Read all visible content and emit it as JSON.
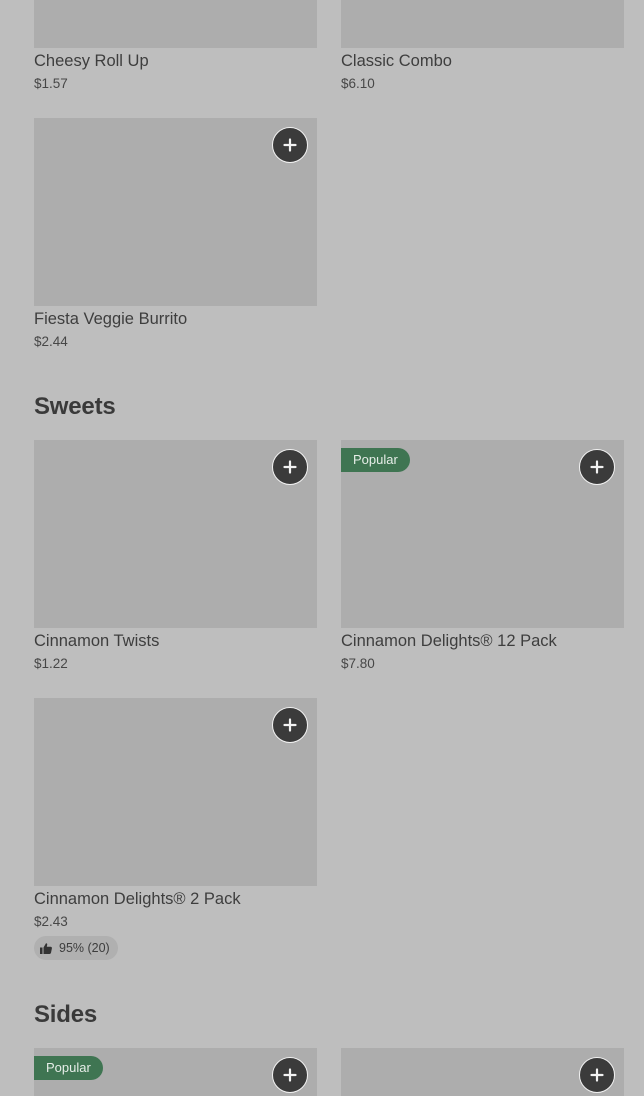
{
  "sections": [
    {
      "title": ""
    },
    {
      "title": "Sweets"
    },
    {
      "title": "Sides"
    }
  ],
  "items": [
    {
      "name": "Cheesy Roll Up",
      "price": "$1.57"
    },
    {
      "name": "Classic Combo",
      "price": "$6.10"
    },
    {
      "name": "Fiesta Veggie Burrito",
      "price": "$2.44"
    },
    {
      "name": "Cinnamon Twists",
      "price": "$1.22"
    },
    {
      "name": "Cinnamon Delights® 12 Pack",
      "price": "$7.80",
      "badge": "Popular"
    },
    {
      "name": "Cinnamon Delights® 2 Pack",
      "price": "$2.43",
      "rating": "95% (20)"
    },
    {
      "badge": "Popular"
    },
    {}
  ],
  "icons": {
    "add": "plus-icon",
    "rating": "thumbs-up-icon"
  },
  "colors": {
    "badge": "#3f7552",
    "add_button": "#3b3b3b",
    "background": "#bebebe",
    "thumbnail": "#adadad"
  }
}
